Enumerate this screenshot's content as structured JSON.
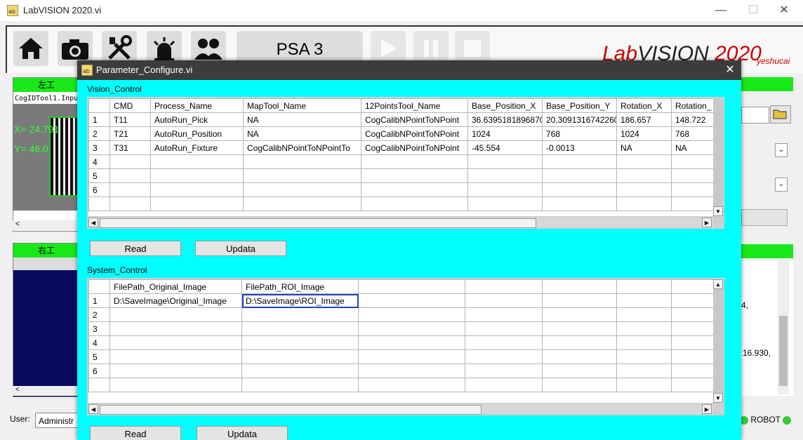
{
  "main_window": {
    "title": "LabVISION 2020.vi",
    "psa_label": "PSA 3",
    "logo_lab": "LabVISION 2020",
    "logo_sub": "yeshucai",
    "left_panel1_title": "左工",
    "left_panel1_label": "CogIDTool1.Inpu",
    "left_panel1_x": "X= 24.791",
    "left_panel1_y": "Y= 46.0",
    "left_panel2_title": "右工",
    "user_label": "User:",
    "user_value": "Administr",
    "right_text1": "4,",
    "right_text2": "16.930,",
    "robot_label": "ROBOT"
  },
  "dialog": {
    "title": "Parameter_Configure.vi",
    "vision_control": {
      "label": "Vision_Control",
      "columns": [
        "CMD",
        "Process_Name",
        "MapTool_Name",
        "12PointsTool_Name",
        "Base_Position_X",
        "Base_Position_Y",
        "Rotation_X",
        "Rotation_"
      ],
      "rows": [
        {
          "idx": "1",
          "cells": [
            "T11",
            "AutoRun_Pick",
            "NA",
            "CogCalibNPointToNPoint",
            "36.6395181896870",
            "20.3091316742260",
            "186.657",
            "148.722"
          ]
        },
        {
          "idx": "2",
          "cells": [
            "T21",
            "AutoRun_Position",
            "NA",
            "CogCalibNPointToNPoint",
            "1024",
            "768",
            "1024",
            "768"
          ]
        },
        {
          "idx": "3",
          "cells": [
            "T31",
            "AutoRun_Fixture",
            "CogCalibNPointToNPointTo",
            "CogCalibNPointToNPoint",
            "-45.554",
            "-0.0013",
            "NA",
            "NA"
          ]
        },
        {
          "idx": "4",
          "cells": [
            "",
            "",
            "",
            "",
            "",
            "",
            "",
            ""
          ]
        },
        {
          "idx": "5",
          "cells": [
            "",
            "",
            "",
            "",
            "",
            "",
            "",
            ""
          ]
        },
        {
          "idx": "6",
          "cells": [
            "",
            "",
            "",
            "",
            "",
            "",
            "",
            ""
          ]
        }
      ],
      "read_label": "Read",
      "update_label": "Updata"
    },
    "system_control": {
      "label": "System_Control",
      "columns": [
        "FilePath_Original_Image",
        "FilePath_ROI_Image",
        "",
        "",
        "",
        "",
        ""
      ],
      "rows": [
        {
          "idx": "1",
          "cells": [
            "D:\\SaveImage\\Original_Image",
            "D:\\SaveImage\\ROI_Image",
            "",
            "",
            "",
            "",
            ""
          ]
        },
        {
          "idx": "2",
          "cells": [
            "",
            "",
            "",
            "",
            "",
            "",
            ""
          ]
        },
        {
          "idx": "3",
          "cells": [
            "",
            "",
            "",
            "",
            "",
            "",
            ""
          ]
        },
        {
          "idx": "4",
          "cells": [
            "",
            "",
            "",
            "",
            "",
            "",
            ""
          ]
        },
        {
          "idx": "5",
          "cells": [
            "",
            "",
            "",
            "",
            "",
            "",
            ""
          ]
        },
        {
          "idx": "6",
          "cells": [
            "",
            "",
            "",
            "",
            "",
            "",
            ""
          ]
        }
      ],
      "read_label": "Read",
      "update_label": "Updata"
    }
  },
  "colors": {
    "dialog_bg": "#00ffff",
    "green_header": "#18e818",
    "selection_border": "#2244bb"
  }
}
